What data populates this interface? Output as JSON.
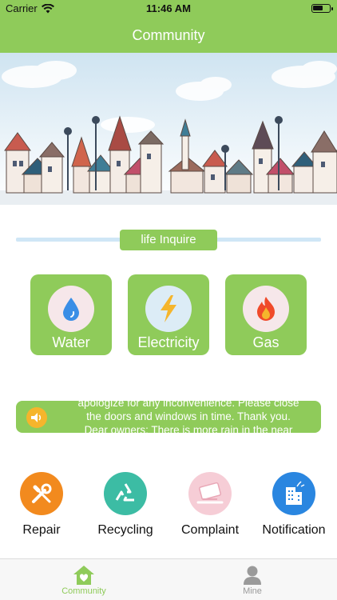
{
  "status_bar": {
    "carrier": "Carrier",
    "time": "11:46 AM"
  },
  "nav": {
    "title": "Community"
  },
  "section": {
    "title": "life Inquire"
  },
  "utilities": [
    {
      "label": "Water",
      "icon": "water-drop-icon",
      "color": "#3a8ee6"
    },
    {
      "label": "Electricity",
      "icon": "lightning-icon",
      "color": "#f5b52c"
    },
    {
      "label": "Gas",
      "icon": "flame-icon",
      "color": "#f04a2a"
    }
  ],
  "notice": {
    "lines": [
      "apologize for any inconvenience. Please close",
      "the doors and windows in time. Thank you.",
      "Dear owners: There is more rain in the near"
    ]
  },
  "services": [
    {
      "label": "Repair",
      "icon": "wrench-screwdriver-icon",
      "color": "#f28a1e"
    },
    {
      "label": "Recycling",
      "icon": "recycle-icon",
      "color": "#3cbca4"
    },
    {
      "label": "Complaint",
      "icon": "complaint-icon",
      "color": "#f6cdd6"
    },
    {
      "label": "Notification",
      "icon": "building-icon",
      "color": "#2a86e0"
    }
  ],
  "tabs": [
    {
      "label": "Community",
      "active": true
    },
    {
      "label": "Mine",
      "active": false
    }
  ],
  "colors": {
    "accent": "#8fcb5a",
    "inactive": "#9a9a9a"
  }
}
